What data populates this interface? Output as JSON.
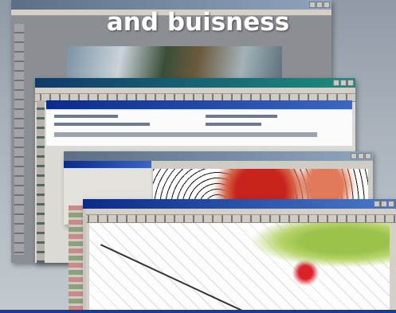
{
  "headline": "and buisness",
  "colors": {
    "background": "#a9b2bb",
    "title_bar": "#0b2b8a",
    "map_highlight_red": "#c8231c",
    "map_green_area": "#9bc24a"
  },
  "windows": [
    {
      "name": "back-window"
    },
    {
      "name": "form-window"
    },
    {
      "name": "map-window"
    },
    {
      "name": "front-map-window"
    }
  ]
}
